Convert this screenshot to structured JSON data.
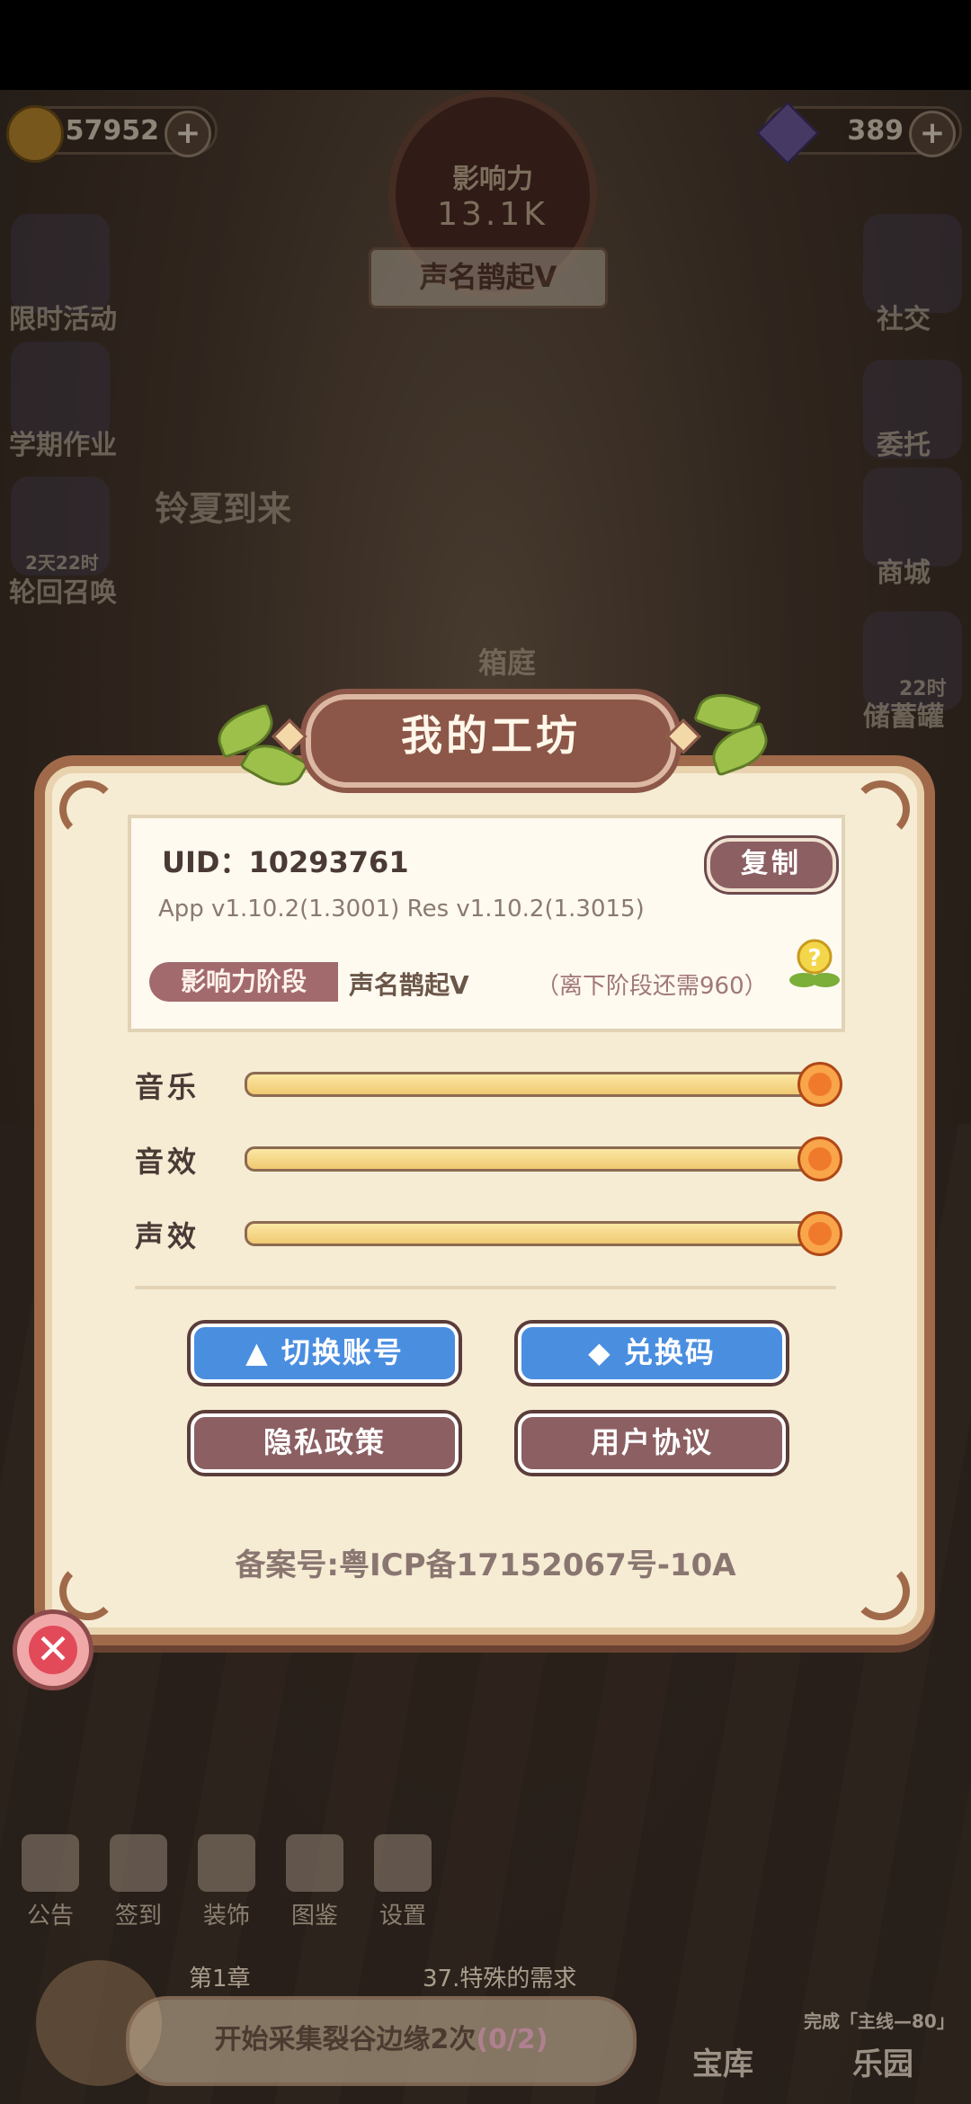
{
  "hud": {
    "coins": "57952",
    "gems": "389",
    "influence_label": "影响力",
    "influence_value": "13.1K",
    "rank_banner": "声名鹊起V"
  },
  "left_sidebar": [
    {
      "label": "限时活动"
    },
    {
      "label": "学期作业"
    },
    {
      "label": "2天22时",
      "sub": "轮回召唤"
    }
  ],
  "right_sidebar": [
    {
      "label": "社交"
    },
    {
      "label": "委托"
    },
    {
      "label": "商城"
    },
    {
      "label": "22时",
      "sub": "储蓄罐"
    }
  ],
  "scene_labels": {
    "event": "铃夏到来",
    "garden": "箱庭"
  },
  "modal": {
    "title": "我的工坊",
    "uid": "UID：10293761",
    "copy_label": "复制",
    "version": "App v1.10.2(1.3001)   Res v1.10.2(1.3015)",
    "stage_tag": "影响力阶段",
    "stage_value": "声名鹊起V",
    "stage_need": "（离下阶段还需960）",
    "sliders": [
      {
        "label": "音乐",
        "value": 1.0
      },
      {
        "label": "音效",
        "value": 1.0
      },
      {
        "label": "声效",
        "value": 1.0
      }
    ],
    "buttons": {
      "switch_account": "切换账号",
      "redeem_code": "兑换码",
      "privacy": "隐私政策",
      "agreement": "用户协议"
    },
    "icp": "备案号:粤ICP备17152067号-10A"
  },
  "bottom_nav": [
    "公告",
    "签到",
    "装饰",
    "图鉴",
    "设置"
  ],
  "quest": {
    "chapter": "第1章",
    "chapter_title": "37.特殊的需求",
    "text": "开始采集裂谷边缘2次",
    "progress": "(0/2)"
  },
  "bottom_right": {
    "vault": "宝库",
    "complete_hint": "完成「主线—80」",
    "park": "乐园"
  }
}
